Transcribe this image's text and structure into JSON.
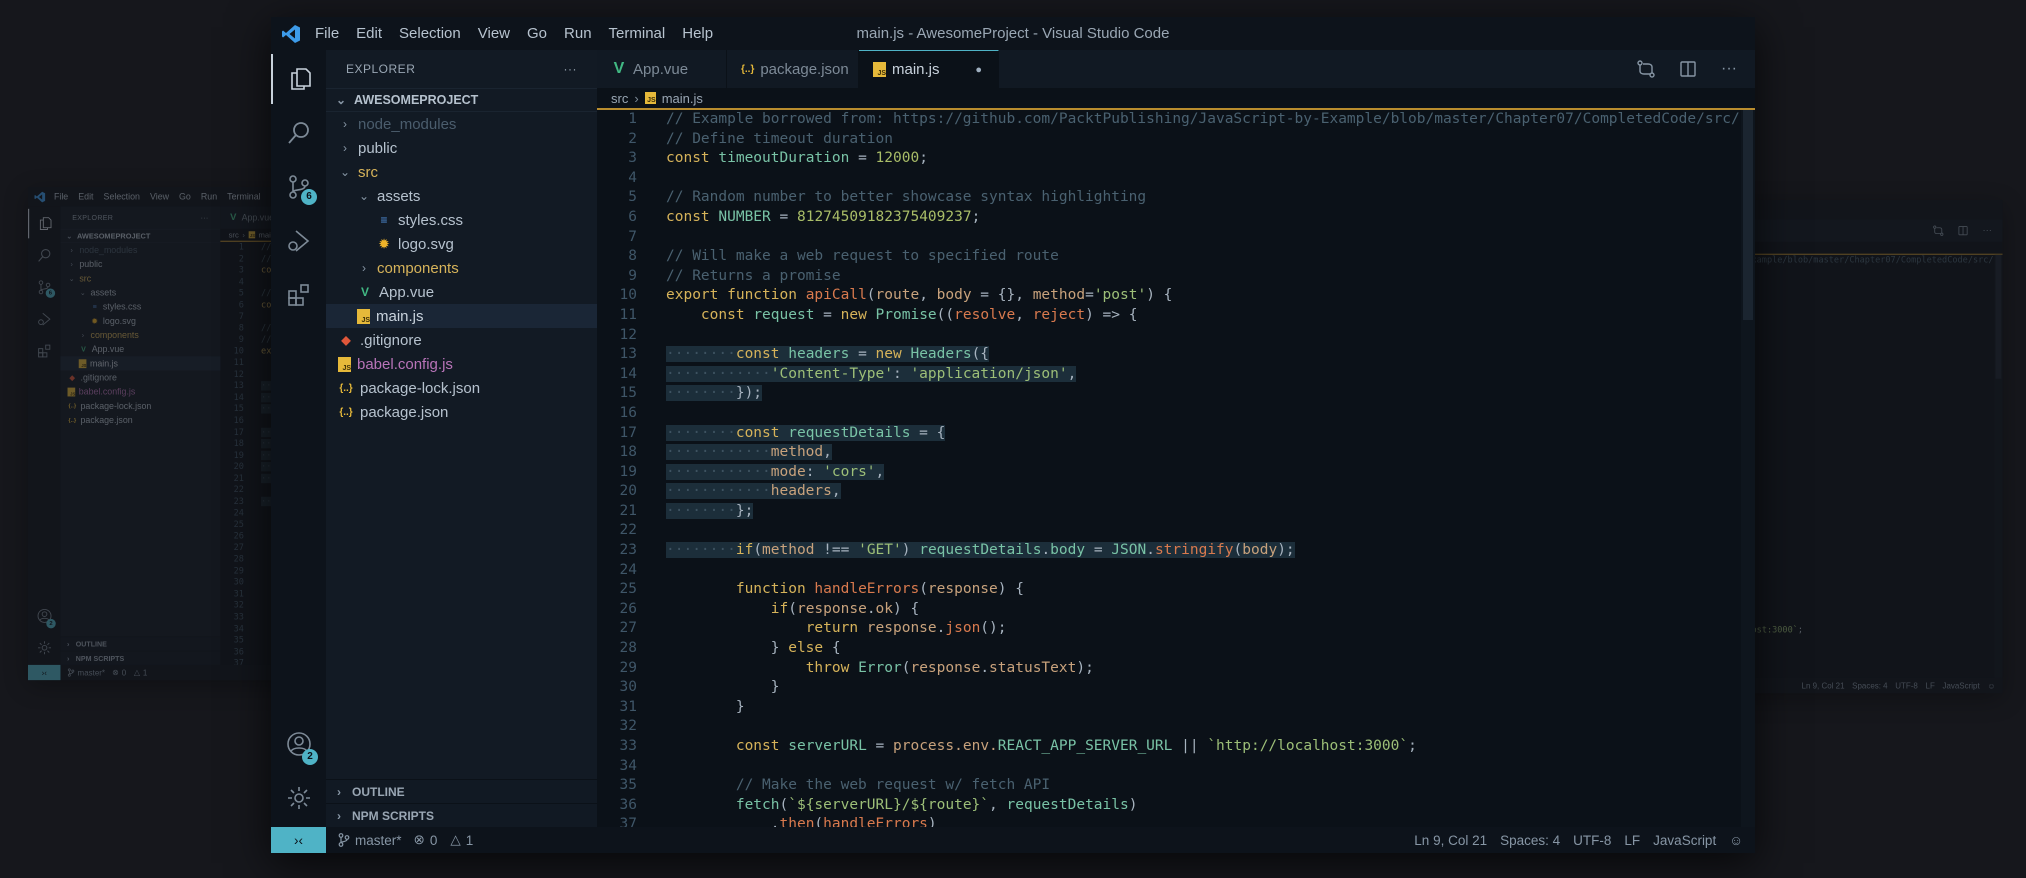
{
  "window": {
    "title": "main.js - AwesomeProject - Visual Studio Code"
  },
  "menu": [
    "File",
    "Edit",
    "Selection",
    "View",
    "Go",
    "Run",
    "Terminal",
    "Help"
  ],
  "activity": {
    "source_control_badge": "6",
    "accounts_badge": "2"
  },
  "explorer": {
    "title": "EXPLORER",
    "more": "···",
    "project": "AWESOMEPROJECT",
    "items": [
      {
        "label": "node_modules",
        "level": 0,
        "kind": "folder",
        "open": false,
        "color": "#4b5d6d"
      },
      {
        "label": "public",
        "level": 0,
        "kind": "folder",
        "open": false,
        "color": "#b6c2ce"
      },
      {
        "label": "src",
        "level": 0,
        "kind": "folder",
        "open": true,
        "color": "#d6b35a"
      },
      {
        "label": "assets",
        "level": 1,
        "kind": "folder",
        "open": true,
        "color": "#b6c2ce"
      },
      {
        "label": "styles.css",
        "level": 2,
        "kind": "css",
        "color": "#b6c2ce",
        "icon_color": "#4f8fd8"
      },
      {
        "label": "logo.svg",
        "level": 2,
        "kind": "svg",
        "color": "#b6c2ce",
        "icon_color": "#f0b429"
      },
      {
        "label": "components",
        "level": 1,
        "kind": "folder",
        "open": false,
        "color": "#d6b35a"
      },
      {
        "label": "App.vue",
        "level": 1,
        "kind": "vue",
        "color": "#b6c2ce",
        "icon_color": "#41b883"
      },
      {
        "label": "main.js",
        "level": 1,
        "kind": "js",
        "color": "#c8d2dc",
        "selected": true
      },
      {
        "label": ".gitignore",
        "level": 0,
        "kind": "git",
        "color": "#b6c2ce",
        "icon_color": "#e0573a"
      },
      {
        "label": "babel.config.js",
        "level": 0,
        "kind": "js",
        "color": "#b874b8"
      },
      {
        "label": "package-lock.json",
        "level": 0,
        "kind": "json",
        "color": "#b6c2ce",
        "icon_color": "#e6b93a"
      },
      {
        "label": "package.json",
        "level": 0,
        "kind": "json",
        "color": "#b6c2ce",
        "icon_color": "#e6b93a"
      }
    ],
    "panels": [
      "OUTLINE",
      "NPM SCRIPTS"
    ]
  },
  "tabs": [
    {
      "label": "App.vue",
      "icon": "vue-icon",
      "active": false
    },
    {
      "label": "package.json",
      "icon": "json-icon",
      "active": false
    },
    {
      "label": "main.js",
      "icon": "js-icon",
      "active": true,
      "modified": true
    }
  ],
  "breadcrumb": [
    "src",
    "main.js"
  ],
  "code": [
    [
      [
        "c",
        "// Example borrowed from: https://github.com/PacktPublishing/JavaScript-by-Example/blob/master/Chapter07/CompletedCode/src/se"
      ]
    ],
    [
      [
        "c",
        "// Define timeout duration"
      ]
    ],
    [
      [
        "k",
        "const "
      ],
      [
        "v",
        "timeoutDuration"
      ],
      [
        "o",
        " = "
      ],
      [
        "n",
        "12000"
      ],
      [
        "o",
        ";"
      ]
    ],
    [],
    [
      [
        "c",
        "// Random number to better showcase syntax highlighting"
      ]
    ],
    [
      [
        "k",
        "const "
      ],
      [
        "v",
        "NUMBER"
      ],
      [
        "o",
        " = "
      ],
      [
        "n",
        "81274509182375409237"
      ],
      [
        "o",
        ";"
      ]
    ],
    [],
    [
      [
        "c",
        "// Will make a web request to specified route"
      ]
    ],
    [
      [
        "c",
        "// Returns a promise"
      ]
    ],
    [
      [
        "k",
        "export function "
      ],
      [
        "f",
        "apiCall"
      ],
      [
        "o",
        "("
      ],
      [
        "p",
        "route"
      ],
      [
        "o",
        ", "
      ],
      [
        "p",
        "body"
      ],
      [
        "o",
        " = {}, "
      ],
      [
        "p",
        "method"
      ],
      [
        "o",
        "="
      ],
      [
        "s",
        "'post'"
      ],
      [
        "o",
        ") {"
      ]
    ],
    [
      [
        "o",
        "    "
      ],
      [
        "k",
        "const "
      ],
      [
        "v",
        "request"
      ],
      [
        "o",
        " = "
      ],
      [
        "k",
        "new "
      ],
      [
        "t",
        "Promise"
      ],
      [
        "o",
        "(("
      ],
      [
        "f",
        "resolve"
      ],
      [
        "o",
        ", "
      ],
      [
        "f",
        "reject"
      ],
      [
        "o",
        ") => {"
      ]
    ],
    [],
    [
      [
        "w",
        "········"
      ],
      [
        "k",
        "const "
      ],
      [
        "v",
        "headers"
      ],
      [
        "o",
        " = "
      ],
      [
        "k",
        "new "
      ],
      [
        "t",
        "Headers"
      ],
      [
        "o",
        "({"
      ]
    ],
    [
      [
        "w",
        "············"
      ],
      [
        "s",
        "'Content-Type'"
      ],
      [
        "o",
        ": "
      ],
      [
        "s",
        "'application/json'"
      ],
      [
        "o",
        ","
      ]
    ],
    [
      [
        "w",
        "········"
      ],
      [
        "o",
        "});"
      ]
    ],
    [],
    [
      [
        "w",
        "········"
      ],
      [
        "k",
        "const "
      ],
      [
        "v",
        "requestDetails"
      ],
      [
        "o",
        " = {"
      ]
    ],
    [
      [
        "w",
        "············"
      ],
      [
        "p",
        "method"
      ],
      [
        "o",
        ","
      ]
    ],
    [
      [
        "w",
        "············"
      ],
      [
        "p",
        "mode"
      ],
      [
        "o",
        ": "
      ],
      [
        "s",
        "'cors'"
      ],
      [
        "o",
        ","
      ]
    ],
    [
      [
        "w",
        "············"
      ],
      [
        "p",
        "headers"
      ],
      [
        "o",
        ","
      ]
    ],
    [
      [
        "w",
        "········"
      ],
      [
        "o",
        "};"
      ]
    ],
    [],
    [
      [
        "w",
        "········"
      ],
      [
        "k",
        "if"
      ],
      [
        "o",
        "("
      ],
      [
        "p",
        "method"
      ],
      [
        "o",
        " !== "
      ],
      [
        "s",
        "'GET'"
      ],
      [
        "o",
        ") "
      ],
      [
        "v",
        "requestDetails"
      ],
      [
        "o",
        "."
      ],
      [
        "v",
        "body"
      ],
      [
        "o",
        " = "
      ],
      [
        "v",
        "JSON"
      ],
      [
        "o",
        "."
      ],
      [
        "f",
        "stringify"
      ],
      [
        "o",
        "("
      ],
      [
        "p",
        "body"
      ],
      [
        "o",
        ");"
      ]
    ],
    [],
    [
      [
        "o",
        "        "
      ],
      [
        "k",
        "function "
      ],
      [
        "f",
        "handleErrors"
      ],
      [
        "o",
        "("
      ],
      [
        "p",
        "response"
      ],
      [
        "o",
        ") {"
      ]
    ],
    [
      [
        "o",
        "            "
      ],
      [
        "k",
        "if"
      ],
      [
        "o",
        "("
      ],
      [
        "p",
        "response"
      ],
      [
        "o",
        "."
      ],
      [
        "p",
        "ok"
      ],
      [
        "o",
        ") {"
      ]
    ],
    [
      [
        "o",
        "                "
      ],
      [
        "k",
        "return "
      ],
      [
        "p",
        "response"
      ],
      [
        "o",
        "."
      ],
      [
        "f",
        "json"
      ],
      [
        "o",
        "();"
      ]
    ],
    [
      [
        "o",
        "            } "
      ],
      [
        "k",
        "else"
      ],
      [
        "o",
        " {"
      ]
    ],
    [
      [
        "o",
        "                "
      ],
      [
        "k",
        "throw "
      ],
      [
        "t",
        "Error"
      ],
      [
        "o",
        "("
      ],
      [
        "p",
        "response"
      ],
      [
        "o",
        "."
      ],
      [
        "p",
        "statusText"
      ],
      [
        "o",
        ");"
      ]
    ],
    [
      [
        "o",
        "            }"
      ]
    ],
    [
      [
        "o",
        "        }"
      ]
    ],
    [],
    [
      [
        "o",
        "        "
      ],
      [
        "k",
        "const "
      ],
      [
        "v",
        "serverURL"
      ],
      [
        "o",
        " = "
      ],
      [
        "p",
        "process.env."
      ],
      [
        "v",
        "REACT_APP_SERVER_URL"
      ],
      [
        "o",
        " || "
      ],
      [
        "s",
        "`http://localhost:3000`"
      ],
      [
        "o",
        ";"
      ]
    ],
    [],
    [
      [
        "o",
        "        "
      ],
      [
        "c",
        "// Make the web request w/ fetch API"
      ]
    ],
    [
      [
        "o",
        "        "
      ],
      [
        "v",
        "fetch"
      ],
      [
        "o",
        "("
      ],
      [
        "s",
        "`${serverURL}/${route}`"
      ],
      [
        "o",
        ", "
      ],
      [
        "v",
        "requestDetails"
      ],
      [
        "o",
        ")"
      ]
    ],
    [
      [
        "o",
        "            ."
      ],
      [
        "f",
        "then"
      ],
      [
        "o",
        "("
      ],
      [
        "f",
        "handleErrors"
      ],
      [
        "o",
        ")"
      ]
    ]
  ],
  "highlight_lines": [
    13,
    14,
    15,
    17,
    18,
    19,
    20,
    21,
    23
  ],
  "status": {
    "branch": "master*",
    "errors": "0",
    "warnings": "1",
    "position": "Ln 9, Col 21",
    "spaces": "Spaces: 4",
    "encoding": "UTF-8",
    "eol": "LF",
    "language": "JavaScript"
  },
  "colors": {
    "accent": "#4fb3c6",
    "breadcrumb_border": "#b98d2e",
    "editor_bg": "#0b1118",
    "sidebar_bg": "#121a24"
  }
}
